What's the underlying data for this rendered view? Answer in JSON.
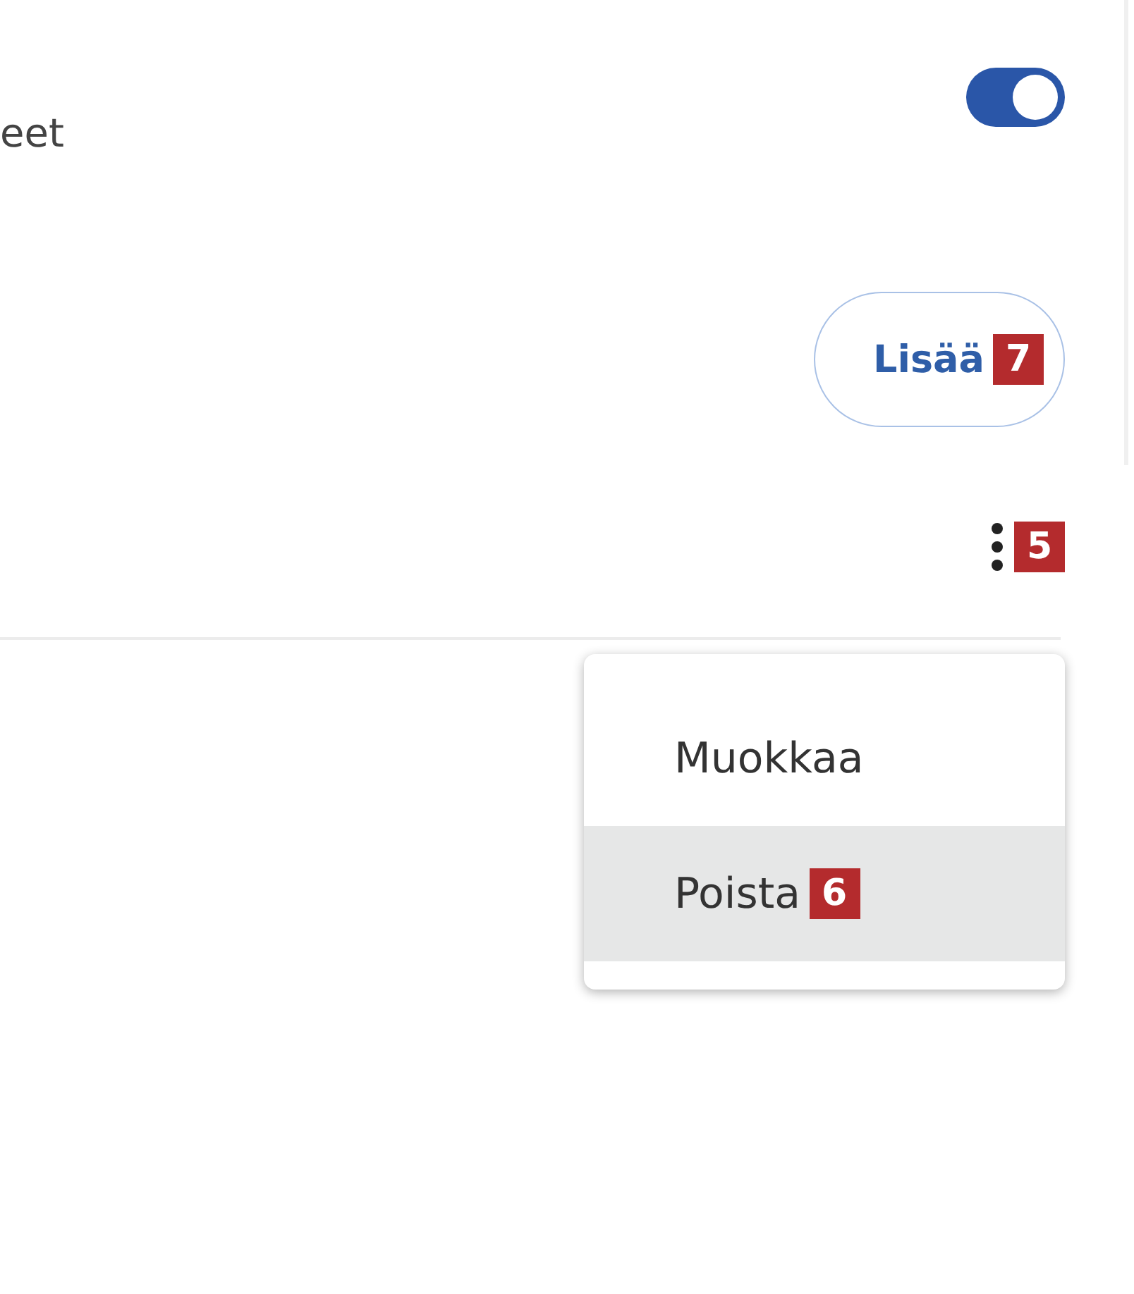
{
  "section_label": "eet",
  "toggle": {
    "on": true
  },
  "add_button": {
    "label": "Lisää",
    "badge": "7"
  },
  "more_button": {
    "badge": "5"
  },
  "menu": {
    "items": [
      {
        "label": "Muokkaa",
        "selected": false
      },
      {
        "label": "Poista",
        "selected": true,
        "badge": "6"
      }
    ]
  }
}
